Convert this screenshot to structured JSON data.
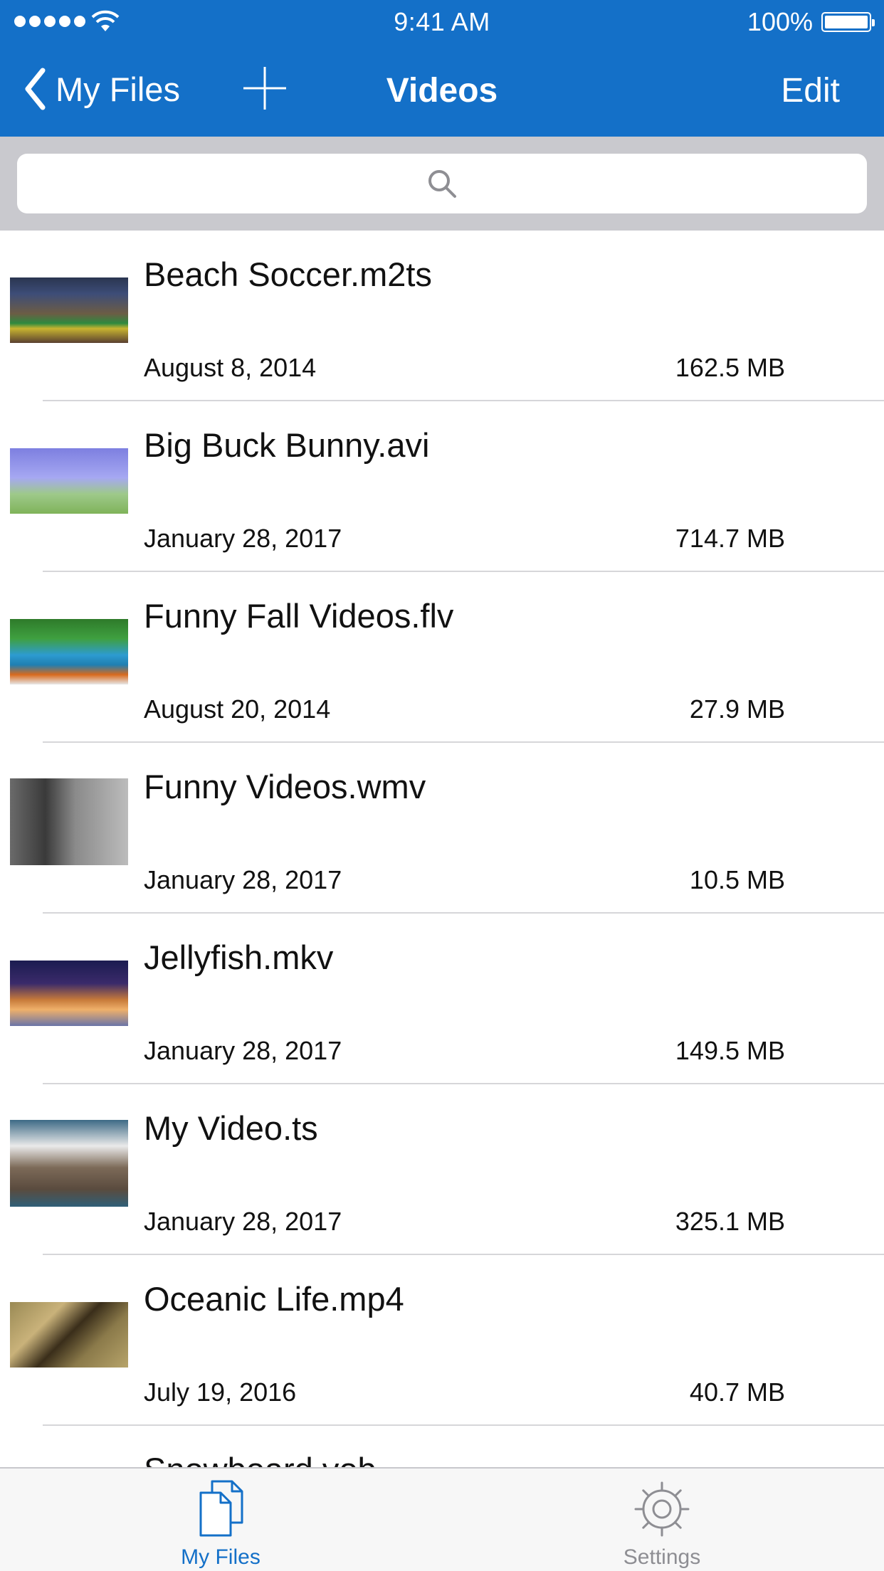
{
  "status_bar": {
    "time": "9:41 AM",
    "battery": "100%"
  },
  "nav": {
    "back_label": "My Files",
    "title": "Videos",
    "edit_label": "Edit"
  },
  "search": {
    "placeholder": ""
  },
  "files": [
    {
      "name": "Beach Soccer.m2ts",
      "date": "August 8, 2014",
      "size": "162.5 MB"
    },
    {
      "name": "Big Buck Bunny.avi",
      "date": "January 28, 2017",
      "size": "714.7 MB"
    },
    {
      "name": "Funny Fall Videos.flv",
      "date": "August 20, 2014",
      "size": "27.9 MB"
    },
    {
      "name": "Funny Videos.wmv",
      "date": "January 28, 2017",
      "size": "10.5 MB"
    },
    {
      "name": "Jellyfish.mkv",
      "date": "January 28, 2017",
      "size": "149.5 MB"
    },
    {
      "name": "My Video.ts",
      "date": "January 28, 2017",
      "size": "325.1 MB"
    },
    {
      "name": "Oceanic Life.mp4",
      "date": "July 19, 2016",
      "size": "40.7 MB"
    },
    {
      "name": "Snowboard.vob",
      "date": "",
      "size": ""
    }
  ],
  "tabs": {
    "files_label": "My Files",
    "settings_label": "Settings"
  },
  "colors": {
    "header": "#1470c8",
    "tab_active": "#1470c8",
    "tab_inactive": "#8e8e93"
  }
}
